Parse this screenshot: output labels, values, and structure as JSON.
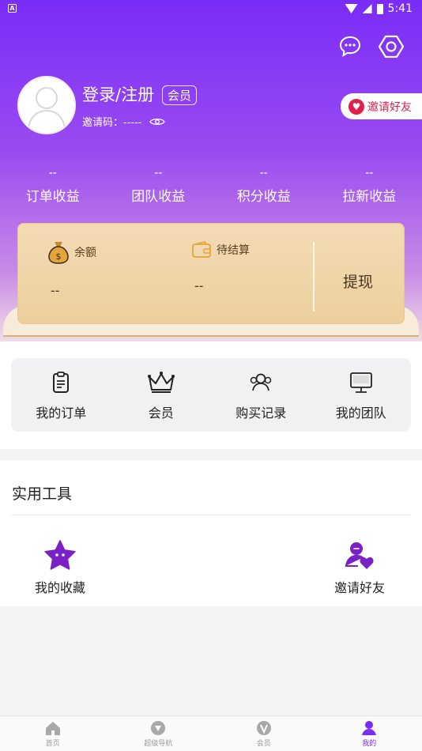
{
  "status_bar": {
    "time": "5:41",
    "left_icon_letter": "A"
  },
  "profile": {
    "login_text": "登录/注册",
    "vip_tag": "会员",
    "invite_code_label": "邀请码：-----"
  },
  "invite_friend_button": "邀请好友",
  "stats": [
    {
      "value": "--",
      "label": "订单收益"
    },
    {
      "value": "--",
      "label": "团队收益"
    },
    {
      "value": "--",
      "label": "积分收益"
    },
    {
      "value": "--",
      "label": "拉新收益"
    }
  ],
  "wallet": {
    "balance_label": "余额",
    "balance_value": "--",
    "pending_label": "待结算",
    "pending_value": "--",
    "withdraw_label": "提现"
  },
  "quick_actions": [
    {
      "label": "我的订单",
      "icon": "clipboard-icon"
    },
    {
      "label": "会员",
      "icon": "crown-icon"
    },
    {
      "label": "购买记录",
      "icon": "users-icon"
    },
    {
      "label": "我的团队",
      "icon": "monitor-icon"
    }
  ],
  "tools": {
    "title": "实用工具",
    "items": [
      {
        "label": "我的收藏",
        "icon": "star-icon"
      },
      {
        "label": "邀请好友",
        "icon": "invite-user-icon"
      }
    ]
  },
  "bottom_nav": [
    {
      "label": "首页",
      "icon": "home-icon",
      "active": false
    },
    {
      "label": "超级导航",
      "icon": "compass-icon",
      "active": false
    },
    {
      "label": "会员",
      "icon": "vip-icon",
      "active": false
    },
    {
      "label": "我的",
      "icon": "profile-icon",
      "active": true
    }
  ],
  "colors": {
    "accent": "#7a2cf8",
    "wallet": "#f0d5a8",
    "heart": "#e0204b"
  }
}
